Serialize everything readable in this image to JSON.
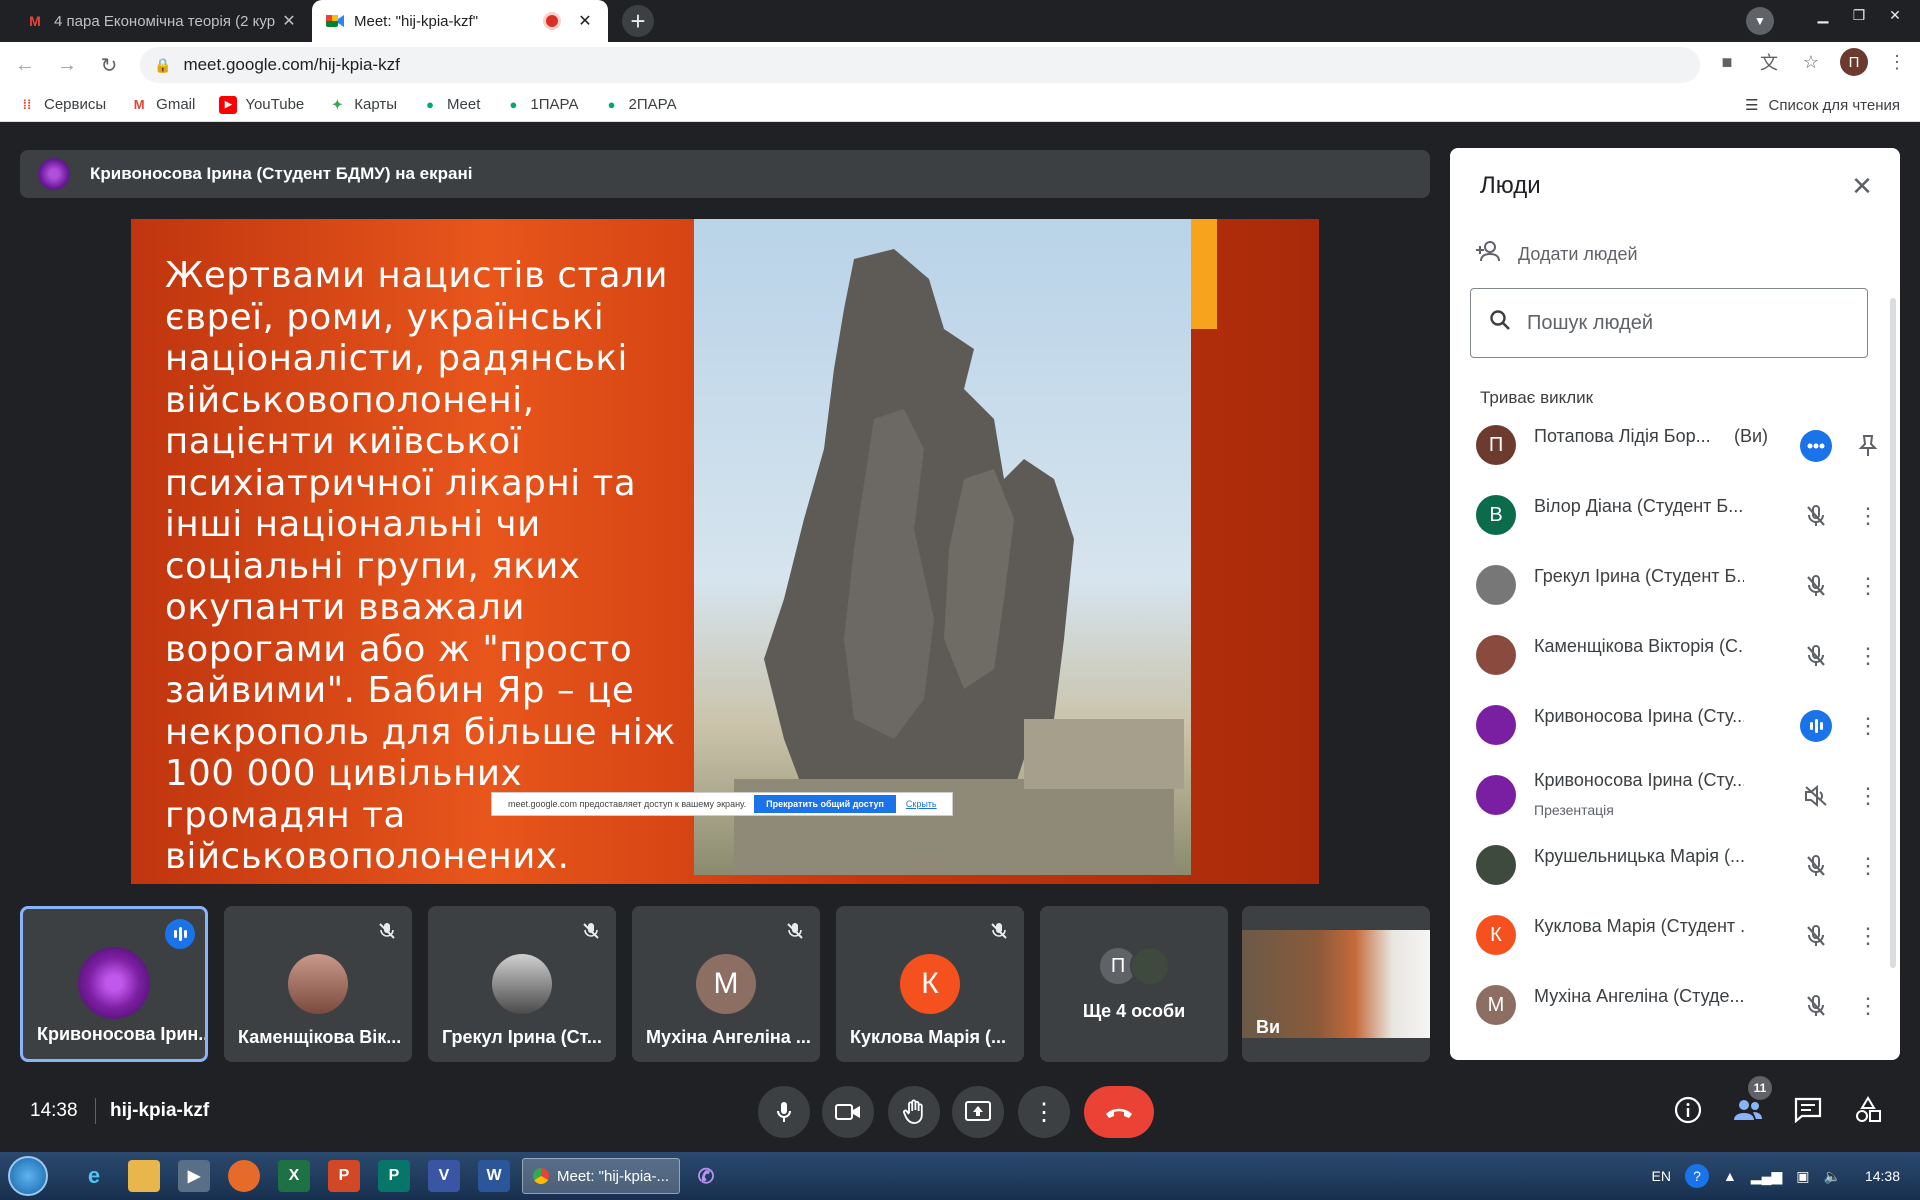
{
  "browser": {
    "tabs": [
      {
        "title": "4 пара Економічна теорія (2 кур",
        "favicon": "gmail-icon"
      },
      {
        "title": "Meet: \"hij-kpia-kzf\"",
        "favicon": "meet-icon"
      }
    ],
    "url": "meet.google.com/hij-kpia-kzf",
    "profile_initial": "П",
    "bookmarks": [
      {
        "label": "Сервисы",
        "icon": "apps-icon"
      },
      {
        "label": "Gmail",
        "icon": "gmail-icon"
      },
      {
        "label": "YouTube",
        "icon": "youtube-icon"
      },
      {
        "label": "Карты",
        "icon": "maps-icon"
      },
      {
        "label": "Meet",
        "icon": "meet-icon"
      },
      {
        "label": "1ПАРА",
        "icon": "meet-icon"
      },
      {
        "label": "2ПАРА",
        "icon": "meet-icon"
      }
    ],
    "reading_list": "Список для чтения"
  },
  "meet": {
    "presenter_label": "Кривоносова Ірина (Студент БДМУ) на екрані",
    "slide_text": "Жертвами нацистів стали євреї, роми, українські націоналісти, радянські військовополонені, пацієнти київської психіатричної лікарні та інші національні чи соціальні групи, яких окупанти вважали ворогами або ж \"просто зайвими\". Бабин Яр – це некрополь для більше ніж 100 000 цивільних громадян та військовополонених.",
    "share_banner": {
      "text": "meet.google.com предоставляет доступ к вашему экрану.",
      "stop": "Прекратить общий доступ",
      "hide": "Скрыть"
    },
    "tiles": [
      {
        "name": "Кривоносова Ірин...",
        "speaking": true
      },
      {
        "name": "Каменщікова Вік..."
      },
      {
        "name": "Грекул Ірина (Ст..."
      },
      {
        "name": "Мухіна Ангеліна ...",
        "initial": "М"
      },
      {
        "name": "Куклова Марія (...",
        "initial": "К"
      },
      {
        "name": "Ще 4 особи",
        "initial": "П"
      },
      {
        "name": "Ви"
      }
    ],
    "clock": "14:38",
    "meeting_code": "hij-kpia-kzf",
    "participant_count": "11"
  },
  "people_panel": {
    "title": "Люди",
    "add_people": "Додати людей",
    "search_placeholder": "Пошук людей",
    "section": "Триває виклик",
    "participants": [
      {
        "name": "Потапова Лідія Бор...",
        "you": "(Ви)",
        "initial": "П",
        "color": "#6d3b2e",
        "mic": "more"
      },
      {
        "name": "Вілор Діана (Студент Б...",
        "initial": "В",
        "color": "#0b6b4b",
        "mic": "muted"
      },
      {
        "name": "Грекул Ірина (Студент Б...",
        "initial": "",
        "color": "#777777",
        "mic": "muted"
      },
      {
        "name": "Каменщікова Вікторія (С...",
        "initial": "",
        "color": "#8a4a3e",
        "mic": "muted"
      },
      {
        "name": "Кривоносова Ірина (Сту...",
        "initial": "",
        "color": "#7b1fa2",
        "mic": "speaking"
      },
      {
        "name": "Кривоносова Ірина (Сту...",
        "sub": "Презентація",
        "initial": "",
        "color": "#7b1fa2",
        "mic": "volume-off"
      },
      {
        "name": "Крушельницька Марія (...",
        "initial": "",
        "color": "#3e4a3e",
        "mic": "muted"
      },
      {
        "name": "Куклова Марія (Студент ...",
        "initial": "К",
        "color": "#f4511e",
        "mic": "muted"
      },
      {
        "name": "Мухіна Ангеліна (Студе...",
        "initial": "М",
        "color": "#8d6e63",
        "mic": "muted"
      }
    ]
  },
  "taskbar": {
    "chrome_window": "Meet: \"hij-kpia-...",
    "lang": "EN",
    "time": "14:38"
  }
}
